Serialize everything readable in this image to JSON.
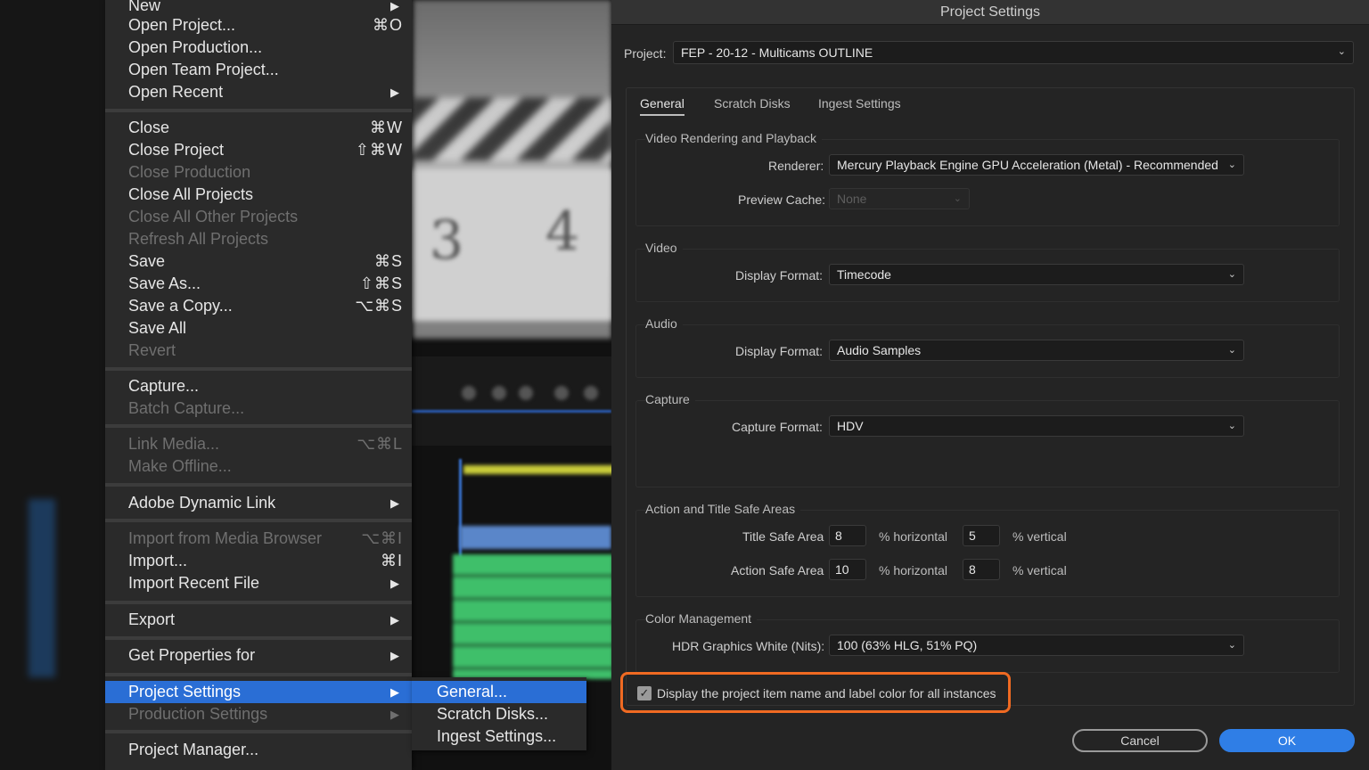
{
  "file_menu": {
    "items": [
      {
        "label": "New",
        "shortcut": "",
        "arrow": true,
        "disabled": false
      },
      {
        "label": "Open Project...",
        "shortcut": "⌘O",
        "arrow": false,
        "disabled": false
      },
      {
        "label": "Open Production...",
        "shortcut": "",
        "arrow": false,
        "disabled": false
      },
      {
        "label": "Open Team Project...",
        "shortcut": "",
        "arrow": false,
        "disabled": false
      },
      {
        "label": "Open Recent",
        "shortcut": "",
        "arrow": true,
        "disabled": false
      },
      {
        "label": "Close",
        "shortcut": "⌘W",
        "arrow": false,
        "disabled": false
      },
      {
        "label": "Close Project",
        "shortcut": "⇧⌘W",
        "arrow": false,
        "disabled": false
      },
      {
        "label": "Close Production",
        "shortcut": "",
        "arrow": false,
        "disabled": true
      },
      {
        "label": "Close All Projects",
        "shortcut": "",
        "arrow": false,
        "disabled": false
      },
      {
        "label": "Close All Other Projects",
        "shortcut": "",
        "arrow": false,
        "disabled": true
      },
      {
        "label": "Refresh All Projects",
        "shortcut": "",
        "arrow": false,
        "disabled": true
      },
      {
        "label": "Save",
        "shortcut": "⌘S",
        "arrow": false,
        "disabled": false
      },
      {
        "label": "Save As...",
        "shortcut": "⇧⌘S",
        "arrow": false,
        "disabled": false
      },
      {
        "label": "Save a Copy...",
        "shortcut": "⌥⌘S",
        "arrow": false,
        "disabled": false
      },
      {
        "label": "Save All",
        "shortcut": "",
        "arrow": false,
        "disabled": false
      },
      {
        "label": "Revert",
        "shortcut": "",
        "arrow": false,
        "disabled": true
      },
      {
        "label": "Capture...",
        "shortcut": "",
        "arrow": false,
        "disabled": false
      },
      {
        "label": "Batch Capture...",
        "shortcut": "",
        "arrow": false,
        "disabled": true
      },
      {
        "label": "Link Media...",
        "shortcut": "⌥⌘L",
        "arrow": false,
        "disabled": true
      },
      {
        "label": "Make Offline...",
        "shortcut": "",
        "arrow": false,
        "disabled": true
      },
      {
        "label": "Adobe Dynamic Link",
        "shortcut": "",
        "arrow": true,
        "disabled": false
      },
      {
        "label": "Import from Media Browser",
        "shortcut": "⌥⌘I",
        "arrow": false,
        "disabled": true
      },
      {
        "label": "Import...",
        "shortcut": "⌘I",
        "arrow": false,
        "disabled": false
      },
      {
        "label": "Import Recent File",
        "shortcut": "",
        "arrow": true,
        "disabled": false
      },
      {
        "label": "Export",
        "shortcut": "",
        "arrow": true,
        "disabled": false
      },
      {
        "label": "Get Properties for",
        "shortcut": "",
        "arrow": true,
        "disabled": false
      },
      {
        "label": "Project Settings",
        "shortcut": "",
        "arrow": true,
        "disabled": false,
        "highlighted": true
      },
      {
        "label": "Production Settings",
        "shortcut": "",
        "arrow": true,
        "disabled": true
      },
      {
        "label": "Project Manager...",
        "shortcut": "",
        "arrow": false,
        "disabled": false
      }
    ]
  },
  "submenu": {
    "items": [
      {
        "label": "General...",
        "highlighted": true
      },
      {
        "label": "Scratch Disks...",
        "highlighted": false
      },
      {
        "label": "Ingest Settings...",
        "highlighted": false
      }
    ]
  },
  "dialog": {
    "title": "Project Settings",
    "project_label": "Project:",
    "project_value": "FEP - 20-12 - Multicams OUTLINE",
    "tabs": [
      "General",
      "Scratch Disks",
      "Ingest Settings"
    ],
    "active_tab": "General",
    "sections": {
      "video_rendering": {
        "title": "Video Rendering and Playback",
        "renderer_label": "Renderer:",
        "renderer_value": "Mercury Playback Engine GPU Acceleration (Metal) - Recommended",
        "preview_cache_label": "Preview Cache:",
        "preview_cache_value": "None"
      },
      "video": {
        "title": "Video",
        "display_format_label": "Display Format:",
        "display_format_value": "Timecode"
      },
      "audio": {
        "title": "Audio",
        "display_format_label": "Display Format:",
        "display_format_value": "Audio Samples"
      },
      "capture": {
        "title": "Capture",
        "capture_format_label": "Capture Format:",
        "capture_format_value": "HDV"
      },
      "safe_areas": {
        "title": "Action and Title Safe Areas",
        "title_safe_label": "Title Safe Area",
        "title_safe_h": "8",
        "title_safe_v": "5",
        "action_safe_label": "Action Safe Area",
        "action_safe_h": "10",
        "action_safe_v": "8",
        "horizontal_unit": "% horizontal",
        "vertical_unit": "% vertical"
      },
      "color_management": {
        "title": "Color Management",
        "hdr_label": "HDR Graphics White (Nits):",
        "hdr_value": "100 (63% HLG, 51% PQ)"
      }
    },
    "checkbox_label": "Display the project item name and label color for all instances",
    "checkbox_checked": true,
    "cancel_label": "Cancel",
    "ok_label": "OK"
  },
  "colors": {
    "accent": "#2a6ed5",
    "ok_button": "#2f7ee6",
    "highlight_outline": "#f06a22"
  }
}
